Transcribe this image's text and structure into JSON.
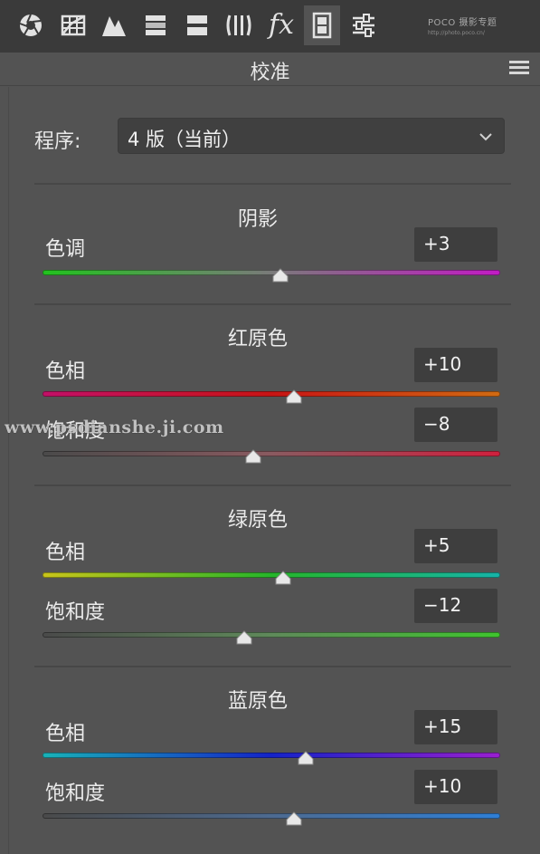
{
  "toolbar": {
    "tools": [
      {
        "icon": "basic-aperture-icon"
      },
      {
        "icon": "tone-curve-grid-icon"
      },
      {
        "icon": "detail-triangle-icon"
      },
      {
        "icon": "hsl-bars-icon"
      },
      {
        "icon": "split-toning-icon"
      },
      {
        "icon": "lens-corrections-icon"
      },
      {
        "icon": "fx-effects-icon",
        "glyph": "fx"
      },
      {
        "icon": "camera-calibration-filmstrip-icon",
        "active": true
      },
      {
        "icon": "presets-sliders-icon"
      }
    ],
    "watermark_logo": "POCO 摄影专题",
    "watermark_url": "http://photo.poco.cn/"
  },
  "panel": {
    "title": "校准"
  },
  "process": {
    "label": "程序:",
    "selected": "4 版（当前）"
  },
  "sections": [
    {
      "title": "阴影",
      "sliders": [
        {
          "label": "色调",
          "value": "+3",
          "position": 0.52,
          "gradient": [
            "#22c21e",
            "#7a7a7a",
            "#c21bc4"
          ]
        }
      ]
    },
    {
      "title": "红原色",
      "sliders": [
        {
          "label": "色相",
          "value": "+10",
          "position": 0.55,
          "gradient": [
            "#c21068",
            "#c81414",
            "#d16b12"
          ]
        },
        {
          "label": "饱和度",
          "value": "−8",
          "position": 0.46,
          "gradient": [
            "#4a4a4a",
            "#8a5a60",
            "#d0203e"
          ]
        }
      ]
    },
    {
      "title": "绿原色",
      "sliders": [
        {
          "label": "色相",
          "value": "+5",
          "position": 0.525,
          "gradient": [
            "#c9c41a",
            "#26b52a",
            "#16b3a8"
          ]
        },
        {
          "label": "饱和度",
          "value": "−12",
          "position": 0.44,
          "gradient": [
            "#4a4a4a",
            "#5f8a5a",
            "#3fc42e"
          ]
        }
      ]
    },
    {
      "title": "蓝原色",
      "sliders": [
        {
          "label": "色相",
          "value": "+15",
          "position": 0.575,
          "gradient": [
            "#19b3b8",
            "#1423c8",
            "#9a1fd0"
          ]
        },
        {
          "label": "饱和度",
          "value": "+10",
          "position": 0.55,
          "gradient": [
            "#4a4a4a",
            "#4d6a90",
            "#2f7fd6"
          ]
        }
      ]
    }
  ],
  "watermark": "www.psdianshe.ji.com"
}
